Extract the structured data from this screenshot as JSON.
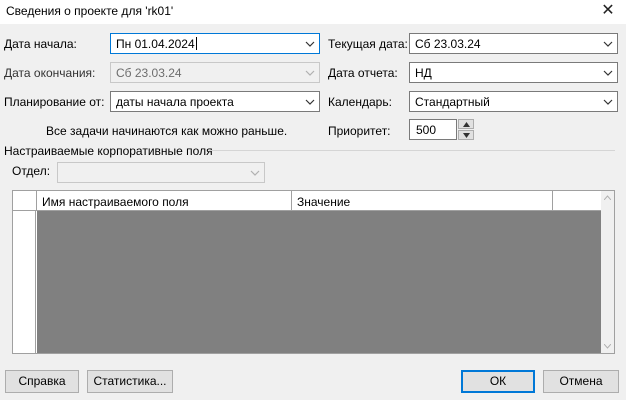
{
  "window": {
    "title": "Сведения о проекте для 'rk01'"
  },
  "fields": {
    "start_date": {
      "label": "Дата начала:",
      "value": "Пн 01.04.2024"
    },
    "finish_date": {
      "label": "Дата окончания:",
      "value": "Сб 23.03.24"
    },
    "schedule_from": {
      "label": "Планирование от:",
      "value": "даты начала проекта"
    },
    "schedule_note": "Все задачи начинаются как можно раньше.",
    "current_date": {
      "label": "Текущая дата:",
      "value": "Сб 23.03.24"
    },
    "status_date": {
      "label": "Дата отчета:",
      "value": "НД"
    },
    "calendar": {
      "label": "Календарь:",
      "value": "Стандартный"
    },
    "priority": {
      "label": "Приоритет:",
      "value": "500"
    }
  },
  "custom_fields": {
    "group_label": "Настраиваемые корпоративные поля",
    "department_label": "Отдел:",
    "department_value": "",
    "columns": [
      "Имя настраиваемого поля",
      "Значение"
    ]
  },
  "buttons": {
    "help": "Справка",
    "statistics": "Статистика...",
    "ok": "ОК",
    "cancel": "Отмена"
  },
  "icons": {
    "close": "close-icon",
    "dropdown": "chevron-down-icon",
    "spin_up": "spin-up-icon",
    "spin_down": "spin-down-icon"
  },
  "colors": {
    "focus_border": "#0078d7",
    "grid_fill": "#808080",
    "dialog_bg": "#f0f0f0"
  }
}
